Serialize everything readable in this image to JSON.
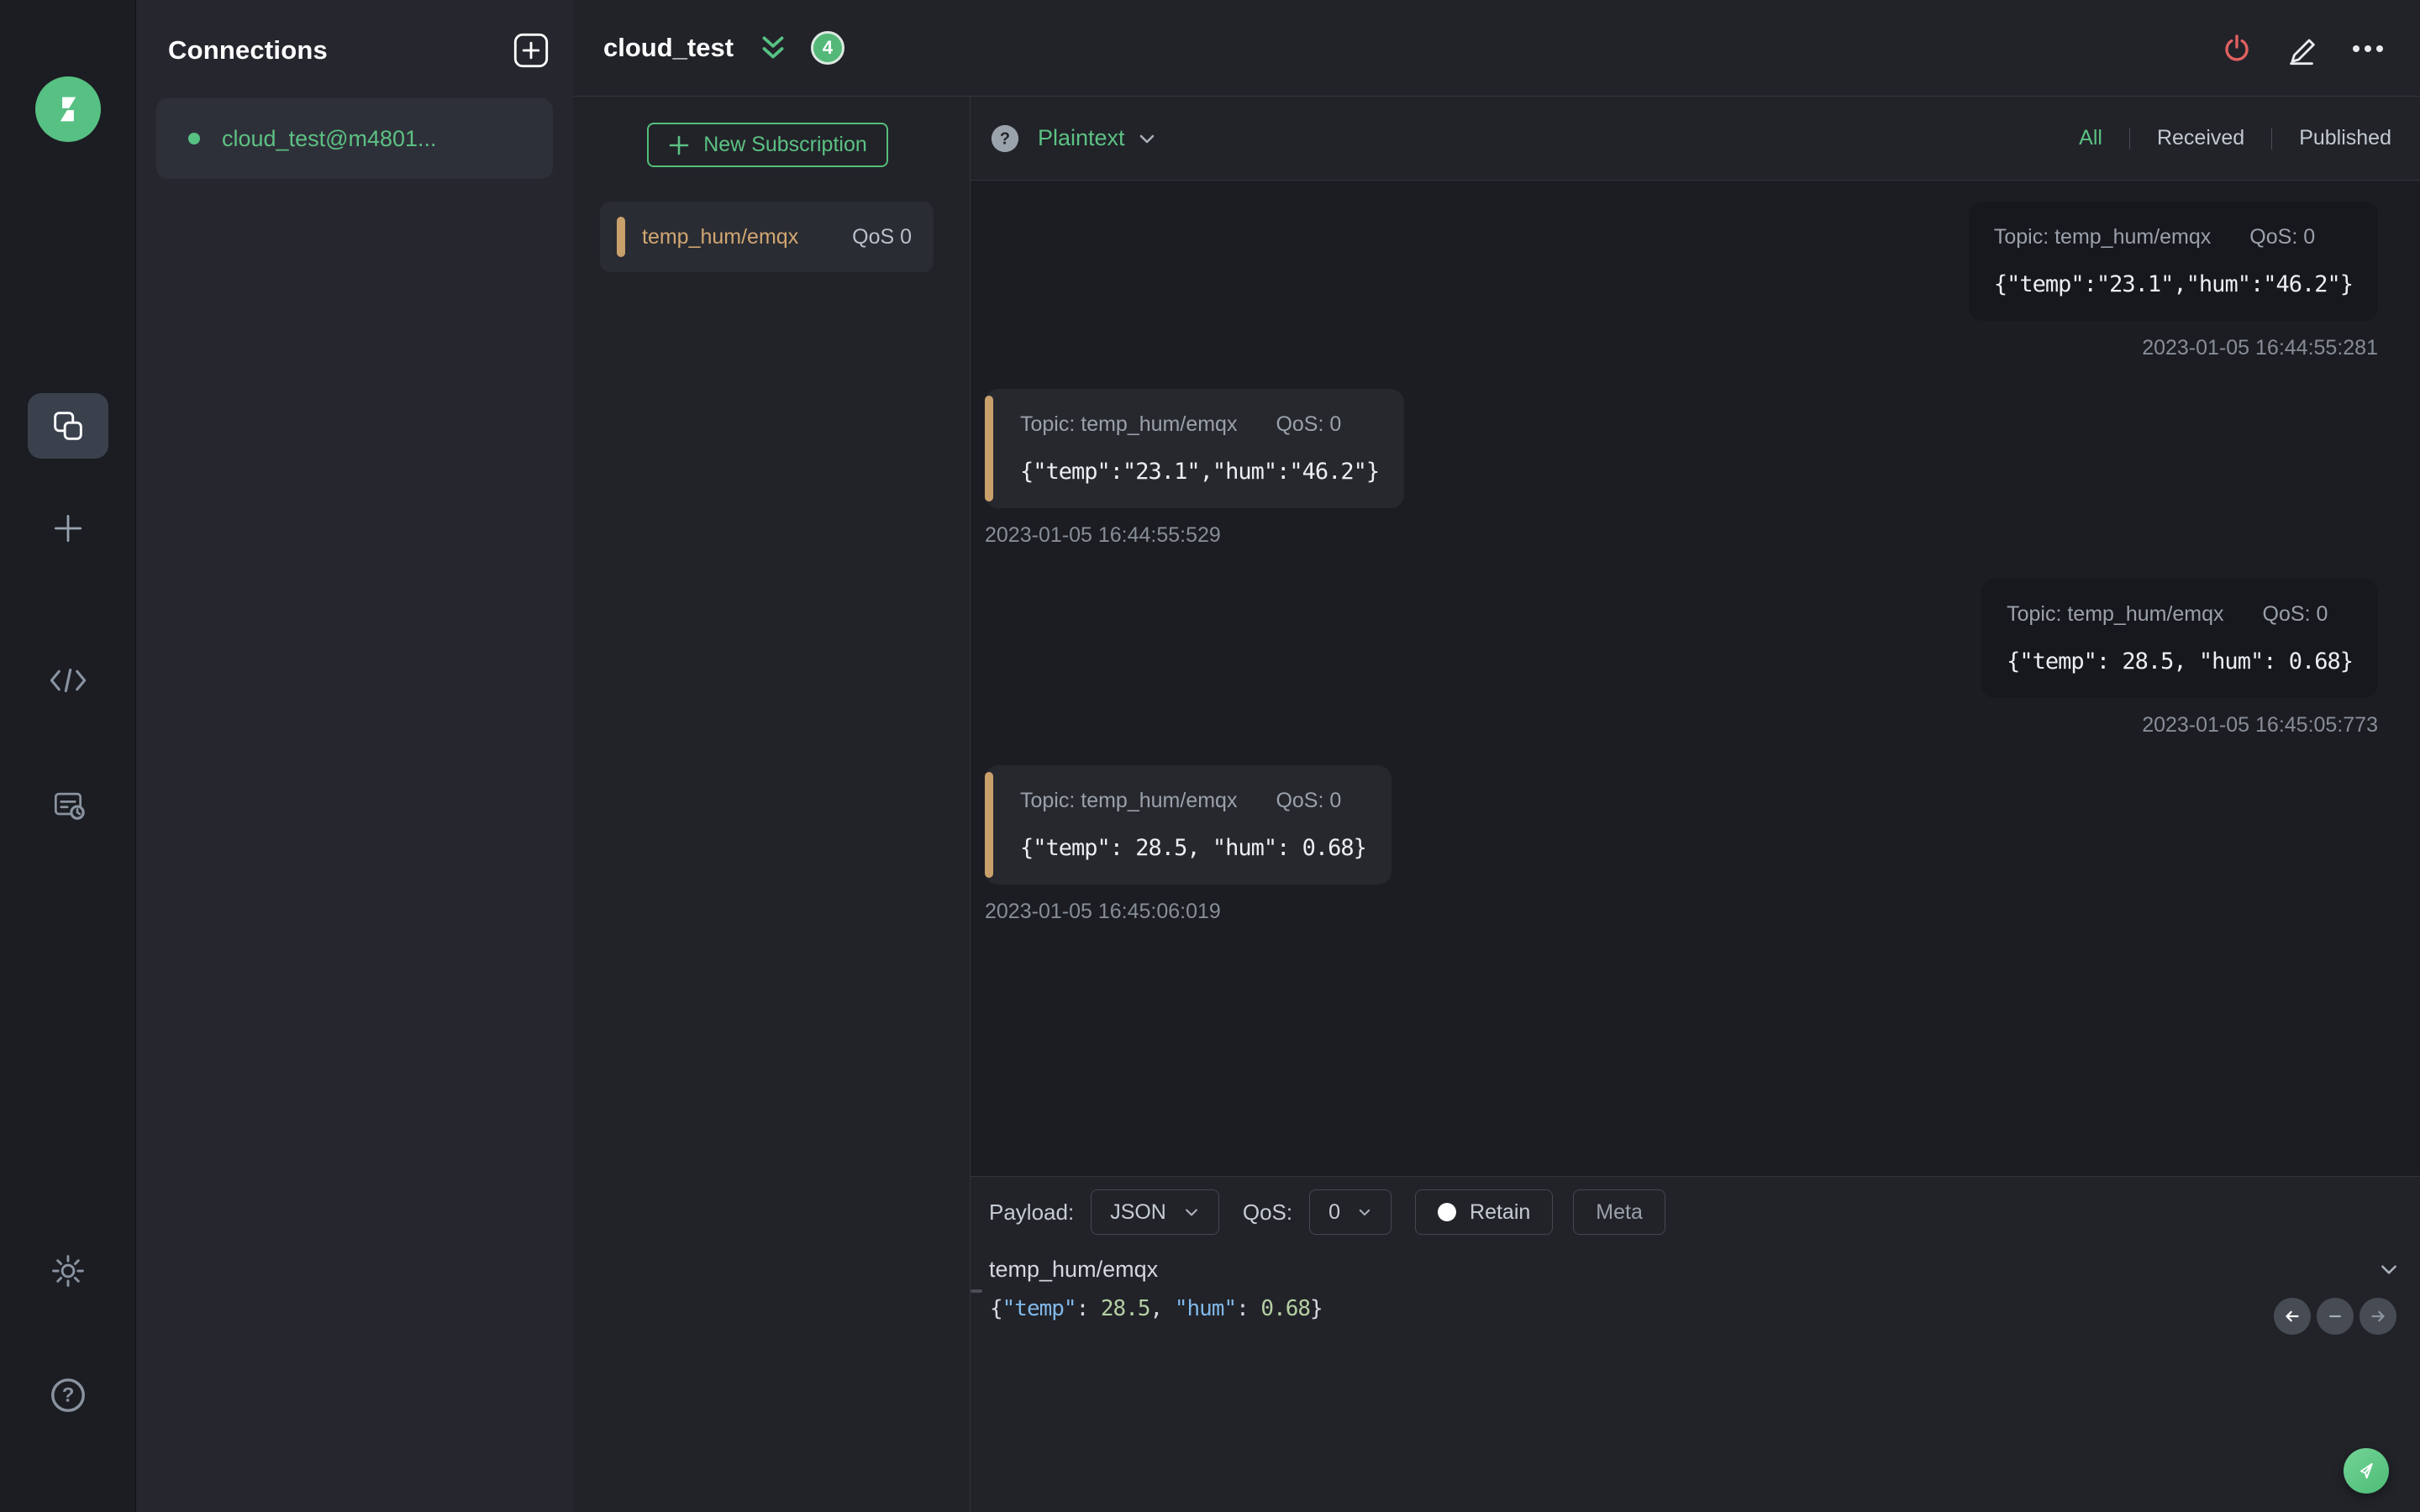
{
  "colors": {
    "accent_green": "#5cc183",
    "accent_tan": "#cda172",
    "danger_red": "#e06060",
    "editor_key_blue": "#82b8e8",
    "editor_number_green": "#b5cfa3"
  },
  "connections_panel": {
    "title": "Connections",
    "items": [
      {
        "name": "cloud_test@m4801...",
        "status": "connected"
      }
    ]
  },
  "header": {
    "title": "cloud_test",
    "badge_count": "4"
  },
  "subscriptions": {
    "new_button": "New Subscription",
    "items": [
      {
        "topic": "temp_hum/emqx",
        "qos": "QoS 0"
      }
    ]
  },
  "messages": {
    "format": "Plaintext",
    "active_filter": "All",
    "filters": [
      "All",
      "Received",
      "Published"
    ],
    "items": [
      {
        "direction": "published",
        "topic": "Topic: temp_hum/emqx",
        "qos": "QoS: 0",
        "payload": "{\"temp\":\"23.1\",\"hum\":\"46.2\"}",
        "timestamp": "2023-01-05 16:44:55:281"
      },
      {
        "direction": "received",
        "topic": "Topic: temp_hum/emqx",
        "qos": "QoS: 0",
        "payload": "{\"temp\":\"23.1\",\"hum\":\"46.2\"}",
        "timestamp": "2023-01-05 16:44:55:529"
      },
      {
        "direction": "published",
        "topic": "Topic: temp_hum/emqx",
        "qos": "QoS: 0",
        "payload": "{\"temp\": 28.5, \"hum\": 0.68}",
        "timestamp": "2023-01-05 16:45:05:773"
      },
      {
        "direction": "received",
        "topic": "Topic: temp_hum/emqx",
        "qos": "QoS: 0",
        "payload": "{\"temp\": 28.5, \"hum\": 0.68}",
        "timestamp": "2023-01-05 16:45:06:019"
      }
    ]
  },
  "publish": {
    "payload_label": "Payload:",
    "payload_type": "JSON",
    "qos_label": "QoS:",
    "qos_value": "0",
    "retain_label": "Retain",
    "meta_label": "Meta",
    "topic": "temp_hum/emqx",
    "editor_tokens": [
      {
        "text": "{",
        "type": "punct"
      },
      {
        "text": "\"temp\"",
        "type": "key"
      },
      {
        "text": ": ",
        "type": "punct"
      },
      {
        "text": "28.5",
        "type": "number"
      },
      {
        "text": ", ",
        "type": "punct"
      },
      {
        "text": "\"hum\"",
        "type": "key"
      },
      {
        "text": ": ",
        "type": "punct"
      },
      {
        "text": "0.68",
        "type": "number"
      },
      {
        "text": "}",
        "type": "punct"
      }
    ]
  }
}
